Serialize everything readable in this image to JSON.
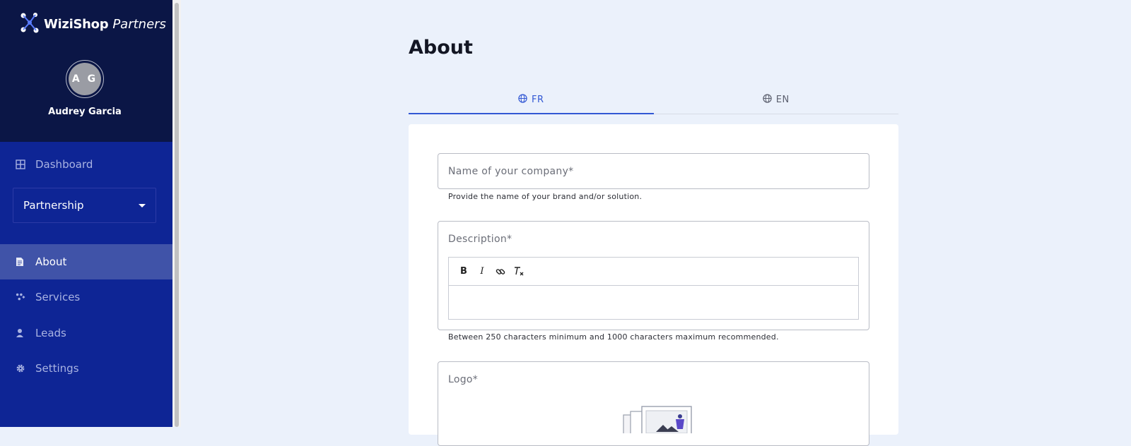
{
  "brand": {
    "name": "WiziShop",
    "suffix": "Partners"
  },
  "user": {
    "initials": "A G",
    "name": "Audrey Garcia"
  },
  "nav": {
    "dashboard": "Dashboard",
    "partnership_select": "Partnership",
    "items": [
      {
        "label": "About",
        "icon": "document-icon",
        "active": true
      },
      {
        "label": "Services",
        "icon": "services-icon",
        "active": false
      },
      {
        "label": "Leads",
        "icon": "user-icon",
        "active": false
      },
      {
        "label": "Settings",
        "icon": "gear-icon",
        "active": false
      }
    ]
  },
  "main": {
    "title": "About",
    "tabs": [
      {
        "label": "FR",
        "active": true
      },
      {
        "label": "EN",
        "active": false
      }
    ],
    "form": {
      "company_placeholder": "Name of your company*",
      "company_helper": "Provide the name of your brand and/or solution.",
      "description_label": "Description*",
      "description_helper": "Between 250 characters minimum and 1000 characters maximum recommended.",
      "logo_label": "Logo*"
    }
  },
  "colors": {
    "sidebar": "#0e2595",
    "sidebar_header": "#0b1646",
    "accent": "#3258d4",
    "background": "#ebf1fb"
  }
}
